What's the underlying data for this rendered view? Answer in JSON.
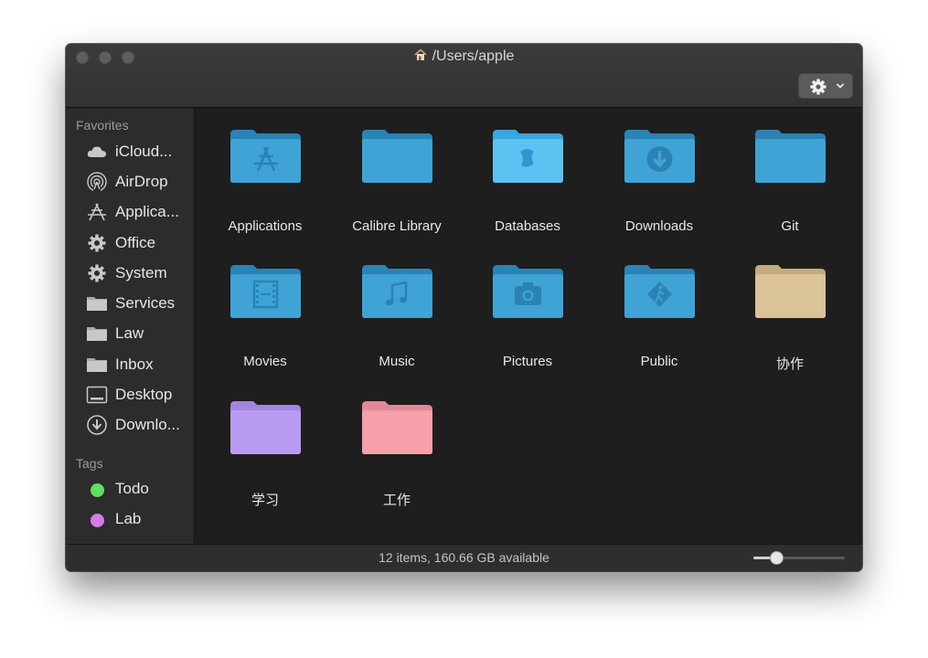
{
  "window": {
    "title": "/Users/apple",
    "title_icon": "home-icon"
  },
  "toolbar": {
    "action_icon": "gear-icon",
    "dropdown_icon": "chevron-down-icon"
  },
  "sidebar": {
    "favorites_header": "Favorites",
    "favorites": [
      {
        "label": "iCloud...",
        "icon": "cloud-icon"
      },
      {
        "label": "AirDrop",
        "icon": "airdrop-icon"
      },
      {
        "label": "Applica...",
        "icon": "applications-icon"
      },
      {
        "label": "Office",
        "icon": "gear-icon"
      },
      {
        "label": "System",
        "icon": "gear-icon"
      },
      {
        "label": "Services",
        "icon": "folder-icon"
      },
      {
        "label": "Law",
        "icon": "folder-icon"
      },
      {
        "label": "Inbox",
        "icon": "folder-icon"
      },
      {
        "label": "Desktop",
        "icon": "desktop-icon"
      },
      {
        "label": "Downlo...",
        "icon": "download-icon"
      }
    ],
    "tags_header": "Tags",
    "tags": [
      {
        "label": "Todo",
        "color": "#5fe05f"
      },
      {
        "label": "Lab",
        "color": "#d67ce8"
      }
    ]
  },
  "items": [
    {
      "name": "Applications",
      "glyph": "applications",
      "color": "#3fa3d6"
    },
    {
      "name": "Calibre Library",
      "glyph": "none",
      "color": "#3fa3d6"
    },
    {
      "name": "Databases",
      "glyph": "finder",
      "color": "#5cc2f2"
    },
    {
      "name": "Downloads",
      "glyph": "download",
      "color": "#3fa3d6"
    },
    {
      "name": "Git",
      "glyph": "none",
      "color": "#3fa3d6"
    },
    {
      "name": "Movies",
      "glyph": "film",
      "color": "#3fa3d6"
    },
    {
      "name": "Music",
      "glyph": "music",
      "color": "#3fa3d6"
    },
    {
      "name": "Pictures",
      "glyph": "camera",
      "color": "#3fa3d6"
    },
    {
      "name": "Public",
      "glyph": "public",
      "color": "#3fa3d6"
    },
    {
      "name": "协作",
      "glyph": "none",
      "color": "#d9c397"
    },
    {
      "name": "学习",
      "glyph": "none",
      "color": "#b99cf2"
    },
    {
      "name": "工作",
      "glyph": "none",
      "color": "#f5a0aa"
    }
  ],
  "status": {
    "text": "12 items, 160.66 GB available",
    "icon_size_fraction": 0.25
  }
}
